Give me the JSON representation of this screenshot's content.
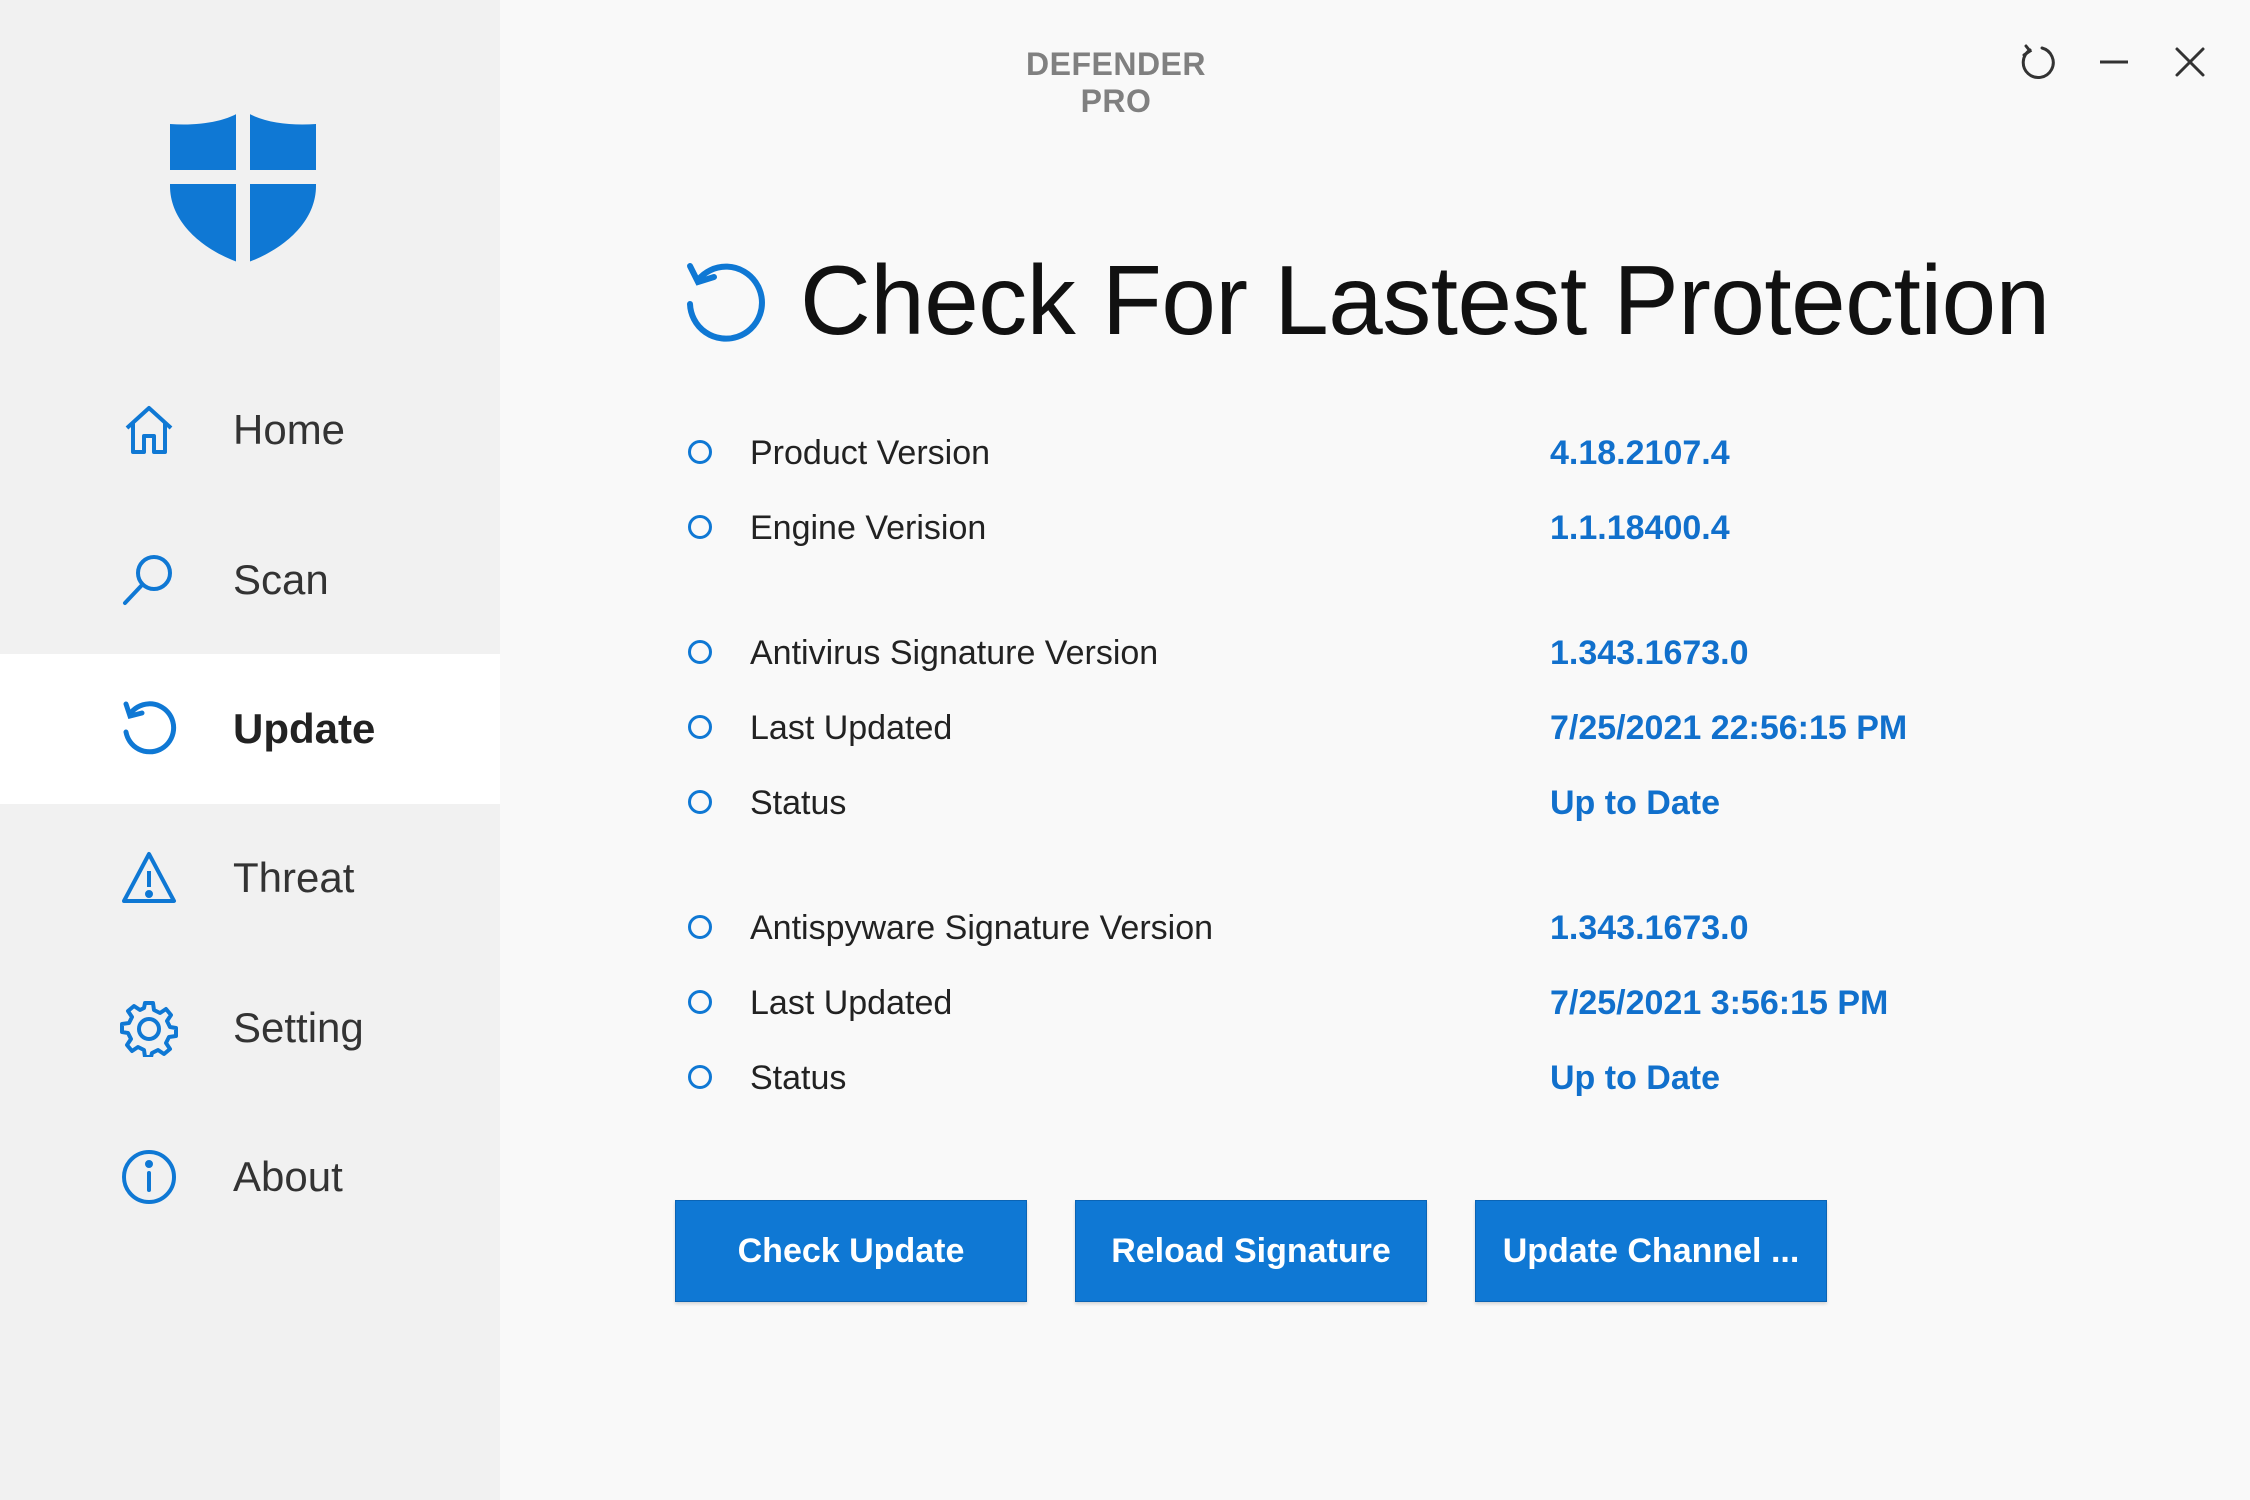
{
  "app": {
    "title": "DEFENDER PRO"
  },
  "window_controls": [
    {
      "name": "refresh",
      "icon": "refresh-icon"
    },
    {
      "name": "minimize",
      "icon": "minimize-icon"
    },
    {
      "name": "close",
      "icon": "close-icon"
    }
  ],
  "sidebar": {
    "logo_icon": "shield-logo-icon",
    "items": [
      {
        "label": "Home",
        "icon": "home-icon",
        "active": false
      },
      {
        "label": "Scan",
        "icon": "search-icon",
        "active": false
      },
      {
        "label": "Update",
        "icon": "update-icon",
        "active": true
      },
      {
        "label": "Threat",
        "icon": "warning-icon",
        "active": false
      },
      {
        "label": "Setting",
        "icon": "gear-icon",
        "active": false
      },
      {
        "label": "About",
        "icon": "info-icon",
        "active": false
      }
    ]
  },
  "main": {
    "heading": "Check For Lastest Protection",
    "heading_icon": "update-icon",
    "rows": [
      {
        "label": "Product Version",
        "value": "4.18.2107.4"
      },
      {
        "label": "Engine Verision",
        "value": "1.1.18400.4"
      },
      {
        "label": "Antivirus Signature Version",
        "value": "1.343.1673.0"
      },
      {
        "label": "Last Updated",
        "value": "7/25/2021 22:56:15 PM"
      },
      {
        "label": "Status",
        "value": "Up to Date"
      },
      {
        "label": "Antispyware Signature Version",
        "value": "1.343.1673.0"
      },
      {
        "label": "Last Updated",
        "value": "7/25/2021 3:56:15 PM"
      },
      {
        "label": "Status",
        "value": "Up to Date"
      }
    ],
    "buttons": {
      "check_update": "Check Update",
      "reload_signature": "Reload Signature",
      "update_channel": "Update Channel ..."
    }
  },
  "colors": {
    "accent": "#0f78d4",
    "value_text": "#1170cc",
    "sidebar_bg": "#f1f1f1",
    "content_bg": "#f9f9f9"
  }
}
